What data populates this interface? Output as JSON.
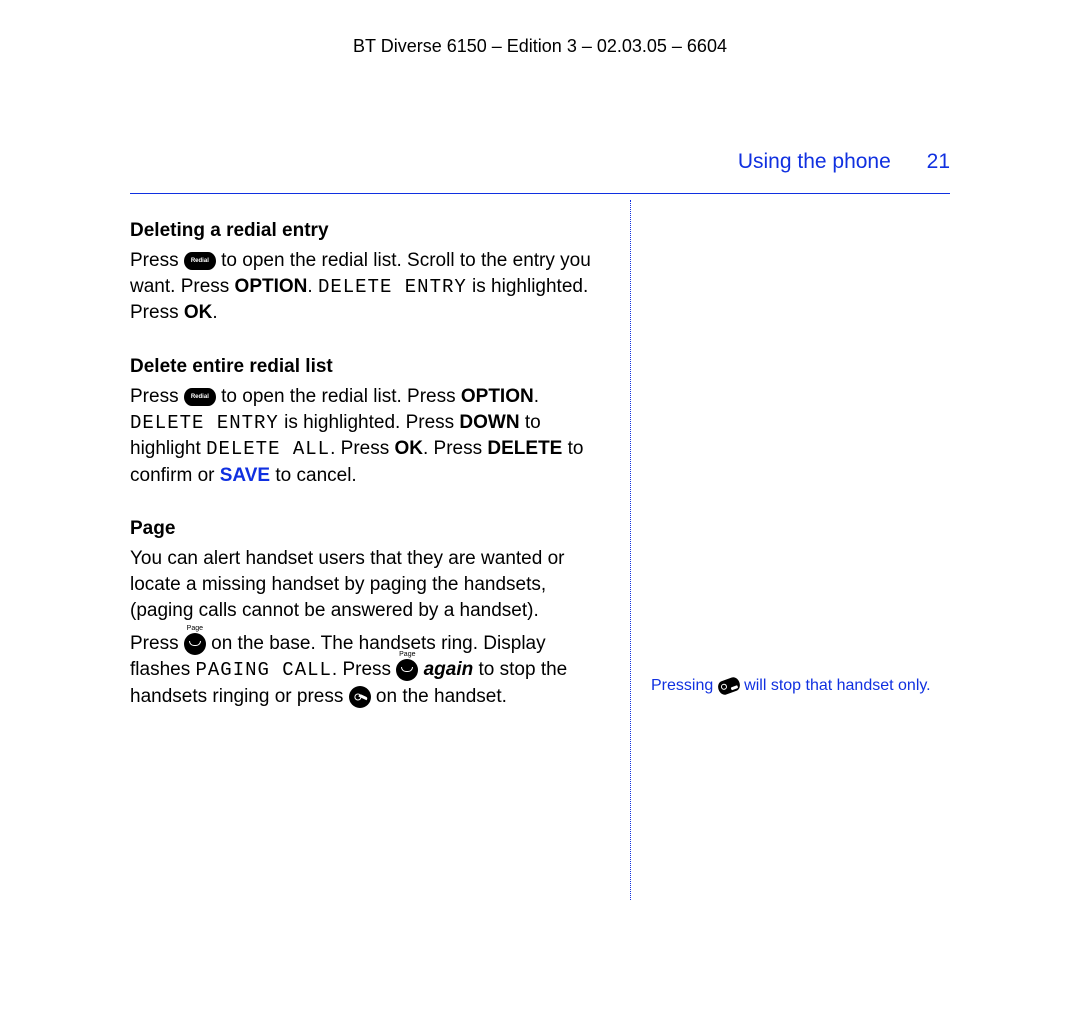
{
  "doc_header": "BT Diverse 6150 – Edition 3 – 02.03.05 – 6604",
  "chapter": "Using the phone",
  "page_number": "21",
  "sections": {
    "del_entry": {
      "title": "Deleting a redial entry",
      "p1_a": "Press ",
      "p1_b": " to open the redial list. Scroll to the entry you want. Press ",
      "p1_option": "OPTION",
      "p1_dot1": ". ",
      "p1_lcd": "DELETE ENTRY",
      "p1_c": " is highlighted. Press ",
      "p1_ok": "OK",
      "p1_dot2": "."
    },
    "del_list": {
      "title": "Delete entire redial list",
      "p1_a": "Press ",
      "p1_b": " to open the redial list. Press ",
      "p1_option": "OPTION",
      "p1_dot1": ". ",
      "p1_lcd1": "DELETE ENTRY",
      "p1_c": " is highlighted. Press ",
      "p1_down": "DOWN",
      "p1_d": " to highlight ",
      "p1_lcd2": "DELETE ALL",
      "p1_e": ". Press ",
      "p1_ok": "OK",
      "p1_f": ". Press ",
      "p1_delete": "DELETE",
      "p1_g": " to confirm or ",
      "p1_save": "SAVE",
      "p1_h": " to cancel."
    },
    "page_sec": {
      "title": "Page",
      "p1": "You can alert handset users that they are wanted or locate a missing handset by paging the handsets, (paging calls cannot be answered by a handset).",
      "p2_a": "Press ",
      "p2_b": " on the base. The handsets ring. Display flashes ",
      "p2_lcd": "PAGING CALL",
      "p2_c": ". Press ",
      "p2_again": "again",
      "p2_d": " to stop the handsets ringing or press ",
      "p2_e": " on the handset."
    }
  },
  "sidenote": {
    "a": "Pressing ",
    "b": " will stop that handset only."
  },
  "icon_labels": {
    "redial": "Redial",
    "page": "Page"
  }
}
